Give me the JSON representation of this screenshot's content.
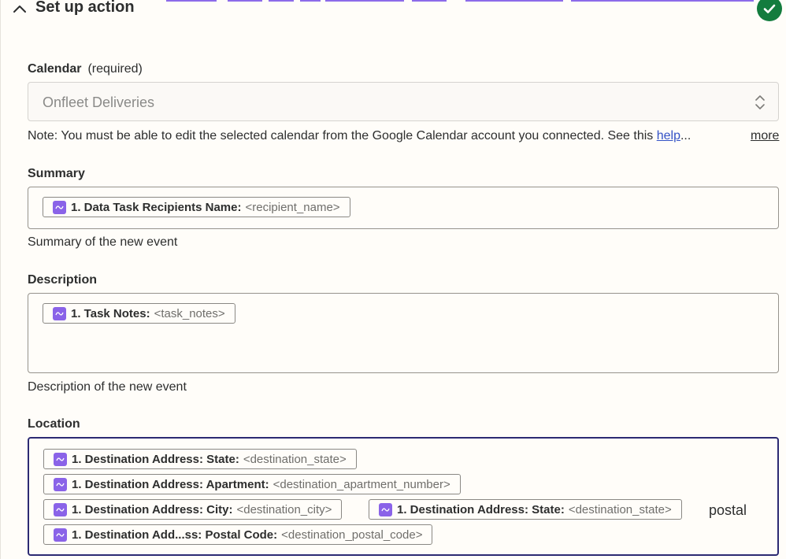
{
  "header": {
    "title": "Set up action",
    "accent_color": "#8c6bea",
    "success_color": "#137c3e"
  },
  "calendar": {
    "label": "Calendar",
    "required_text": "(required)",
    "value": "Onfleet Deliveries",
    "note": "Note: You must be able to edit the selected calendar from the Google Calendar account you connected. See this ",
    "note_link": "help",
    "note_ellipsis": "...",
    "more_link": "more"
  },
  "summary": {
    "label": "Summary",
    "help": "Summary of the new event",
    "pills": [
      {
        "label": "1. Data Task Recipients Name:",
        "token": "<recipient_name>"
      }
    ]
  },
  "description": {
    "label": "Description",
    "help": "Description of the new event",
    "pills": [
      {
        "label": "1. Task Notes:",
        "token": "<task_notes>"
      }
    ]
  },
  "location": {
    "label": "Location",
    "pills": [
      {
        "label": "1. Destination Address: State:",
        "token": "<destination_state>"
      },
      {
        "label": "1. Destination Address: Apartment:",
        "token": "<destination_apartment_number>"
      },
      {
        "label": "1. Destination Address: City:",
        "token": "<destination_city>"
      },
      {
        "label": "1. Destination Address: State:",
        "token": "<destination_state>"
      },
      {
        "label": "1. Destination Add...ss: Postal Code:",
        "token": "<destination_postal_code>"
      }
    ],
    "free_text": "postal"
  },
  "icons": {
    "collapse": "chevron-up-icon",
    "status": "check-icon",
    "select": "sort-arrows-icon",
    "pill_app": "onfleet-app-icon"
  }
}
